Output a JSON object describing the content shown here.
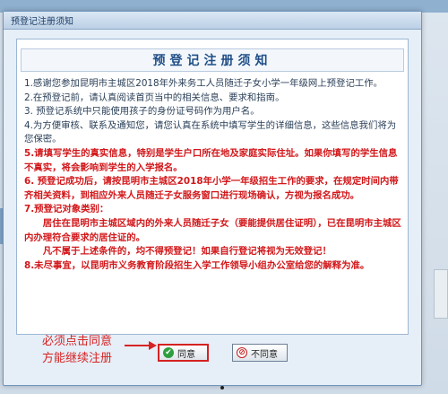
{
  "dialog": {
    "title": "预登记注册须知"
  },
  "notice": {
    "heading": "预登记注册须知",
    "paragraphs": [
      {
        "text": "1.感谢您参加昆明市主城区2018年外来务工人员随迁子女小学一年级网上预登记工作。",
        "style": "normal"
      },
      {
        "text": "2.在预登记前，请认真阅读首页当中的相关信息、要求和指南。",
        "style": "normal"
      },
      {
        "text": "3. 预登记系统中只能使用孩子的身份证号码作为用户名。",
        "style": "normal"
      },
      {
        "text": "4.为方便审核、联系及通知您，请您认真在系统中填写学生的详细信息，这些信息我们将为您保密。",
        "style": "normal"
      },
      {
        "text": "5.请填写学生的真实信息，特别是学生户口所在地及家庭实际住址。如果你填写的学生信息不真实，将会影响到学生的入学报名。",
        "style": "red"
      },
      {
        "text": "6. 预登记成功后，请按昆明市主城区2018年小学一年级招生工作的要求，在规定时间内带齐相关资料，到相应外来人员随迁子女服务窗口进行现场确认，方视为报名成功。",
        "style": "red"
      },
      {
        "text": "7.预登记对象类别：",
        "style": "red"
      },
      {
        "text": "居住在昆明市主城区域内的外来人员随迁子女（要能提供居住证明），已在昆明市主城区内办理符合要求的居住证的。",
        "style": "red-indent"
      },
      {
        "text": "凡不属于上述条件的，均不得预登记！如果自行登记将视为无效登记！",
        "style": "red-indent"
      },
      {
        "text": "8.未尽事宜，以昆明市义务教育阶段招生入学工作领导小组办公室给您的解释为准。",
        "style": "red"
      }
    ]
  },
  "buttons": {
    "agree": "同意",
    "disagree": "不同意"
  },
  "annotation": {
    "line1": "必须点击同意",
    "line2": "方能继续注册"
  },
  "colors": {
    "accent_red": "#d2181b",
    "heading_blue": "#1f4e86",
    "agree_icon": "#2f9e3e"
  }
}
